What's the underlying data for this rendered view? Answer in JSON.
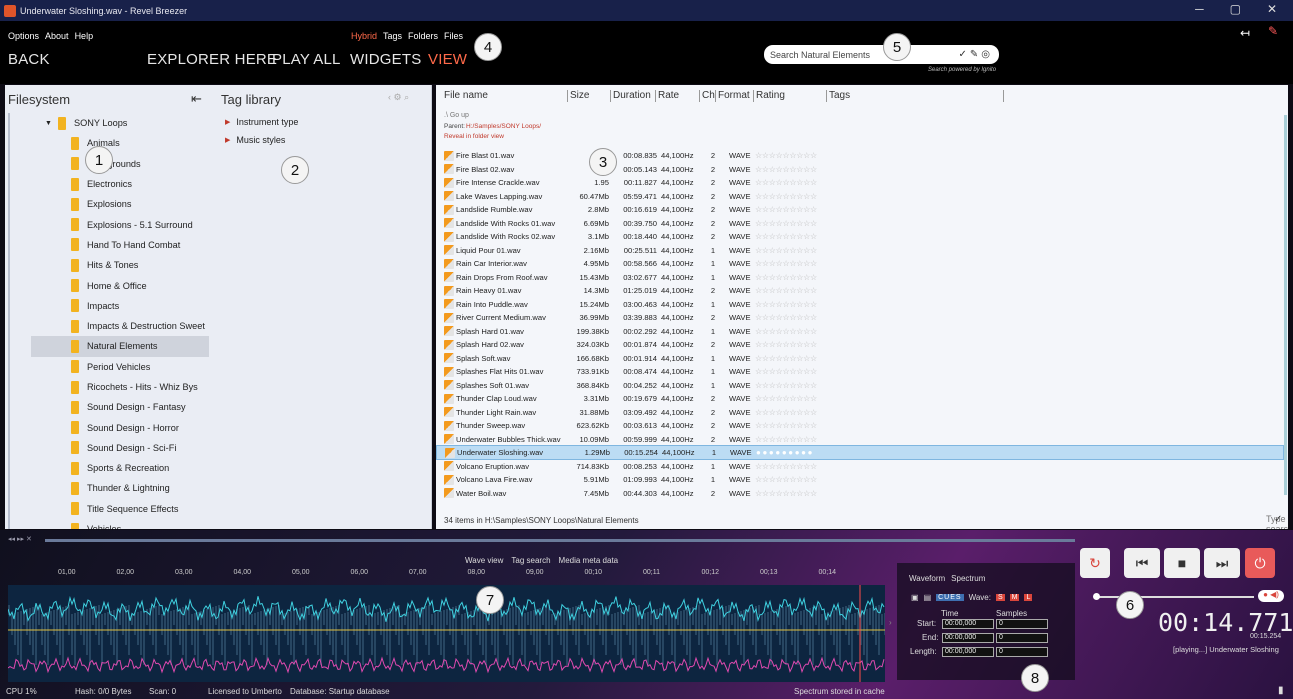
{
  "window": {
    "title": "Underwater Sloshing.wav - Revel Breezer"
  },
  "menu": [
    "Options",
    "About",
    "Help"
  ],
  "nav": {
    "back": "BACK",
    "explorer": "EXPLORER HERE",
    "play_all": "PLAY ALL",
    "widgets": "WIDGETS",
    "view": "VIEW"
  },
  "view_modes": {
    "hybrid": "Hybrid",
    "tags": "Tags",
    "folders": "Folders",
    "files": "Files"
  },
  "search": {
    "placeholder": "Search Natural Elements",
    "powered": "Search powered by Ignito"
  },
  "filesystem": {
    "title": "Filesystem",
    "root": "SONY Loops",
    "folders": [
      "Animals",
      "Backgrounds",
      "Electronics",
      "Explosions",
      "Explosions - 5.1 Surround",
      "Hand To Hand Combat",
      "Hits & Tones",
      "Home & Office",
      "Impacts",
      "Impacts & Destruction Sweet",
      "Natural Elements",
      "Period Vehicles",
      "Ricochets - Hits - Whiz Bys",
      "Sound Design - Fantasy",
      "Sound Design - Horror",
      "Sound Design - Sci-Fi",
      "Sports & Recreation",
      "Thunder & Lightning",
      "Title Sequence Effects",
      "Vehicles"
    ],
    "selected": "Natural Elements"
  },
  "tag_library": {
    "title": "Tag library",
    "items": [
      "Instrument type",
      "Music styles"
    ]
  },
  "files": {
    "headers": [
      "File name",
      "Size",
      "Duration",
      "Rate",
      "Ch",
      "Format",
      "Rating",
      "Tags"
    ],
    "go_up": ".\\ Go up",
    "parent_label": "Parent:",
    "parent_path": "H:/Samples/SONY Loops/",
    "reveal": "Reveal in folder view",
    "rows": [
      [
        "Fire Blast 01.wav",
        "1",
        "00:08.835",
        "44,100Hz",
        "2",
        "WAVE"
      ],
      [
        "Fire Blast 02.wav",
        "88.",
        "00:05.143",
        "44,100Hz",
        "2",
        "WAVE"
      ],
      [
        "Fire Intense Crackle.wav",
        "1.95",
        "00:11.827",
        "44,100Hz",
        "2",
        "WAVE"
      ],
      [
        "Lake Waves Lapping.wav",
        "60.47Mb",
        "05:59.471",
        "44,100Hz",
        "2",
        "WAVE"
      ],
      [
        "Landslide Rumble.wav",
        "2.8Mb",
        "00:16.619",
        "44,100Hz",
        "2",
        "WAVE"
      ],
      [
        "Landslide With Rocks 01.wav",
        "6.69Mb",
        "00:39.750",
        "44,100Hz",
        "2",
        "WAVE"
      ],
      [
        "Landslide With Rocks 02.wav",
        "3.1Mb",
        "00:18.440",
        "44,100Hz",
        "2",
        "WAVE"
      ],
      [
        "Liquid Pour 01.wav",
        "2.16Mb",
        "00:25.511",
        "44,100Hz",
        "1",
        "WAVE"
      ],
      [
        "Rain Car Interior.wav",
        "4.95Mb",
        "00:58.566",
        "44,100Hz",
        "1",
        "WAVE"
      ],
      [
        "Rain Drops From Roof.wav",
        "15.43Mb",
        "03:02.677",
        "44,100Hz",
        "1",
        "WAVE"
      ],
      [
        "Rain Heavy 01.wav",
        "14.3Mb",
        "01:25.019",
        "44,100Hz",
        "2",
        "WAVE"
      ],
      [
        "Rain Into Puddle.wav",
        "15.24Mb",
        "03:00.463",
        "44,100Hz",
        "1",
        "WAVE"
      ],
      [
        "River Current Medium.wav",
        "36.99Mb",
        "03:39.883",
        "44,100Hz",
        "2",
        "WAVE"
      ],
      [
        "Splash Hard 01.wav",
        "199.38Kb",
        "00:02.292",
        "44,100Hz",
        "1",
        "WAVE"
      ],
      [
        "Splash Hard 02.wav",
        "324.03Kb",
        "00:01.874",
        "44,100Hz",
        "2",
        "WAVE"
      ],
      [
        "Splash Soft.wav",
        "166.68Kb",
        "00:01.914",
        "44,100Hz",
        "1",
        "WAVE"
      ],
      [
        "Splashes Flat Hits 01.wav",
        "733.91Kb",
        "00:08.474",
        "44,100Hz",
        "1",
        "WAVE"
      ],
      [
        "Splashes Soft 01.wav",
        "368.84Kb",
        "00:04.252",
        "44,100Hz",
        "1",
        "WAVE"
      ],
      [
        "Thunder Clap Loud.wav",
        "3.31Mb",
        "00:19.679",
        "44,100Hz",
        "2",
        "WAVE"
      ],
      [
        "Thunder Light Rain.wav",
        "31.88Mb",
        "03:09.492",
        "44,100Hz",
        "2",
        "WAVE"
      ],
      [
        "Thunder Sweep.wav",
        "623.62Kb",
        "00:03.613",
        "44,100Hz",
        "2",
        "WAVE"
      ],
      [
        "Underwater Bubbles Thick.wav",
        "10.09Mb",
        "00:59.999",
        "44,100Hz",
        "2",
        "WAVE"
      ],
      [
        "Underwater Sloshing.wav",
        "1.29Mb",
        "00:15.254",
        "44,100Hz",
        "1",
        "WAVE"
      ],
      [
        "Volcano Eruption.wav",
        "714.83Kb",
        "00:08.253",
        "44,100Hz",
        "1",
        "WAVE"
      ],
      [
        "Volcano Lava Fire.wav",
        "5.91Mb",
        "01:09.993",
        "44,100Hz",
        "1",
        "WAVE"
      ],
      [
        "Water Boil.wav",
        "7.45Mb",
        "00:44.303",
        "44,100Hz",
        "2",
        "WAVE"
      ]
    ],
    "selected_index": 22,
    "rating_stars": "☆☆☆☆☆☆☆☆☆",
    "rating_dots": "● ● ● ● ● ● ● ● ●",
    "status": "34 items in H:\\Samples\\SONY Loops\\Natural Elements",
    "filter_placeholder": "Type to search...",
    "check_icon": "✓"
  },
  "wave_tabs": [
    "Wave view",
    "Tag search",
    "Media meta data"
  ],
  "ticks": [
    "01,00",
    "02,00",
    "03,00",
    "04,00",
    "05,00",
    "06,00",
    "07,00",
    "08,00",
    "09,00",
    "00;10",
    "00;11",
    "00;12",
    "00;13",
    "00;14"
  ],
  "cues": {
    "tabs": [
      "Waveform",
      "Spectrum"
    ],
    "cues_label": "CUES",
    "wave_label": "Wave:",
    "wave_s": "S",
    "wave_m": "M",
    "wave_l": "L",
    "time_hdr": "Time",
    "samples_hdr": "Samples",
    "start_label": "Start:",
    "end_label": "End:",
    "length_label": "Length:",
    "start_time": "00:00,000",
    "end_time": "00:00,000",
    "length_time": "00:00,000",
    "start_samples": "0",
    "end_samples": "0",
    "length_samples": "0"
  },
  "player": {
    "time": "00:14.771",
    "total": "00:15.254",
    "now_playing": "[playing...] Underwater Sloshing"
  },
  "statusbar": {
    "cpu": "CPU 1%",
    "hash": "Hash: 0/0 Bytes",
    "scan": "Scan: 0",
    "license": "Licensed to Umberto",
    "database": "Database: Startup database",
    "spectrum": "Spectrum stored in cache"
  },
  "callouts": [
    "1",
    "2",
    "3",
    "4",
    "5",
    "6",
    "7",
    "8"
  ],
  "colors": {
    "accent": "#ff6a4a",
    "selected_row": "#bcdcf4",
    "folder": "#f2b320",
    "title_bar": "#18214a",
    "wave_bg": "#0d2540"
  }
}
